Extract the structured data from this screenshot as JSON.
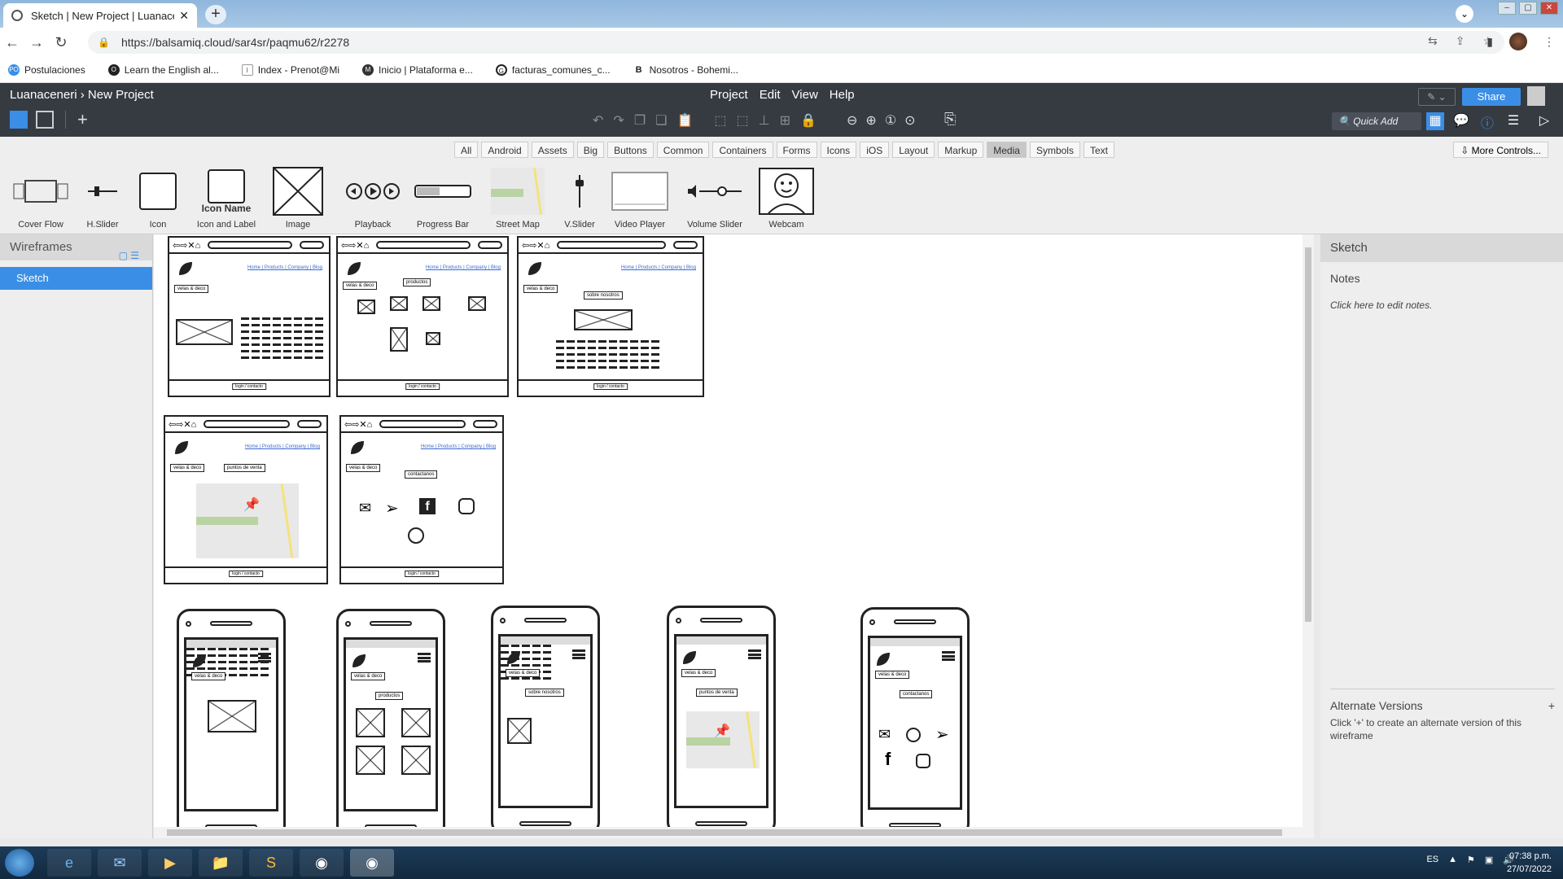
{
  "browser": {
    "tab_title": "Sketch | New Project | Luanacene",
    "url": "https://balsamiq.cloud/sar4sr/paqmu62/r2278",
    "bookmarks": [
      {
        "label": "Postulaciones",
        "icon": "PO"
      },
      {
        "label": "Learn the English al...",
        "icon": "O"
      },
      {
        "label": "Index - Prenot@Mi",
        "icon": "I"
      },
      {
        "label": "Inicio | Plataforma e...",
        "icon": "M"
      },
      {
        "label": "facturas_comunes_c...",
        "icon": "G"
      },
      {
        "label": "Nosotros - Bohemi...",
        "icon": "B"
      }
    ]
  },
  "app": {
    "breadcrumb": "Luanaceneri › New Project",
    "menu": [
      "Project",
      "Edit",
      "View",
      "Help"
    ],
    "share_label": "Share",
    "quick_add": "Quick Add",
    "accent": "#3a8ee6"
  },
  "library": {
    "tabs": [
      "All",
      "Android",
      "Assets",
      "Big",
      "Buttons",
      "Common",
      "Containers",
      "Forms",
      "Icons",
      "iOS",
      "Layout",
      "Markup",
      "Media",
      "Symbols",
      "Text"
    ],
    "active_tab": "Media",
    "more_controls": "More Controls...",
    "items": [
      "Cover Flow",
      "H.Slider",
      "Icon",
      "Icon and Label",
      "Image",
      "Playback",
      "Progress Bar",
      "Street Map",
      "V.Slider",
      "Video Player",
      "Volume Slider",
      "Webcam"
    ],
    "icon_name_caption": "Icon Name"
  },
  "wireframes_panel": {
    "title": "Wireframes",
    "items": [
      "Sketch"
    ]
  },
  "right_panel": {
    "title": "Sketch",
    "notes_label": "Notes",
    "notes_hint": "Click here to edit notes.",
    "alt_title": "Alternate Versions",
    "alt_plus": "+",
    "alt_desc": "Click '+' to create an alternate version of this wireframe"
  },
  "mockup": {
    "menu_links": "Home | Products | Company | Blog",
    "logo_text": "velas & deco",
    "footer_text": "login / contacto",
    "labels": [
      "productos",
      "sobre nosotros",
      "puntos de venta",
      "contactanos"
    ]
  },
  "taskbar": {
    "lang": "ES",
    "time": "07:38 p.m.",
    "date": "27/07/2022"
  }
}
